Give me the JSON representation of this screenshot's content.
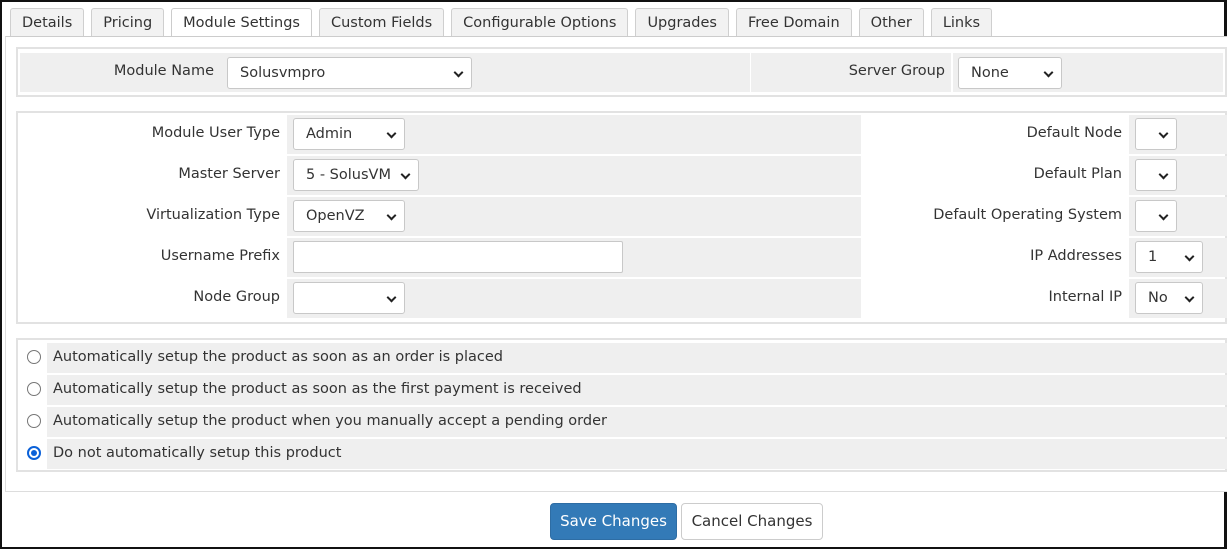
{
  "tabs": [
    {
      "label": "Details"
    },
    {
      "label": "Pricing"
    },
    {
      "label": "Module Settings"
    },
    {
      "label": "Custom Fields"
    },
    {
      "label": "Configurable Options"
    },
    {
      "label": "Upgrades"
    },
    {
      "label": "Free Domain"
    },
    {
      "label": "Other"
    },
    {
      "label": "Links"
    }
  ],
  "active_tab": "Module Settings",
  "module": {
    "name_label": "Module Name",
    "name_value": "Solusvmpro",
    "server_group_label": "Server Group",
    "server_group_value": "None"
  },
  "settings": {
    "module_user_type_label": "Module User Type",
    "module_user_type_value": "Admin",
    "master_server_label": "Master Server",
    "master_server_value": "5 - SolusVM",
    "virtualization_type_label": "Virtualization Type",
    "virtualization_type_value": "OpenVZ",
    "username_prefix_label": "Username Prefix",
    "username_prefix_value": "",
    "node_group_label": "Node Group",
    "node_group_value": "",
    "default_node_label": "Default Node",
    "default_node_value": "",
    "default_plan_label": "Default Plan",
    "default_plan_value": "",
    "default_os_label": "Default Operating System",
    "default_os_value": "",
    "ip_addresses_label": "IP Addresses",
    "ip_addresses_value": "1",
    "internal_ip_label": "Internal IP",
    "internal_ip_value": "No"
  },
  "setup_options": [
    {
      "label": "Automatically setup the product as soon as an order is placed",
      "checked": false
    },
    {
      "label": "Automatically setup the product as soon as the first payment is received",
      "checked": false
    },
    {
      "label": "Automatically setup the product when you manually accept a pending order",
      "checked": false
    },
    {
      "label": "Do not automatically setup this product",
      "checked": true
    }
  ],
  "buttons": {
    "save_label": "Save Changes",
    "cancel_label": "Cancel Changes"
  },
  "colors": {
    "primary_button": "#337ab7",
    "radio_checked": "#0b61d8",
    "cell_background": "#efefef"
  }
}
